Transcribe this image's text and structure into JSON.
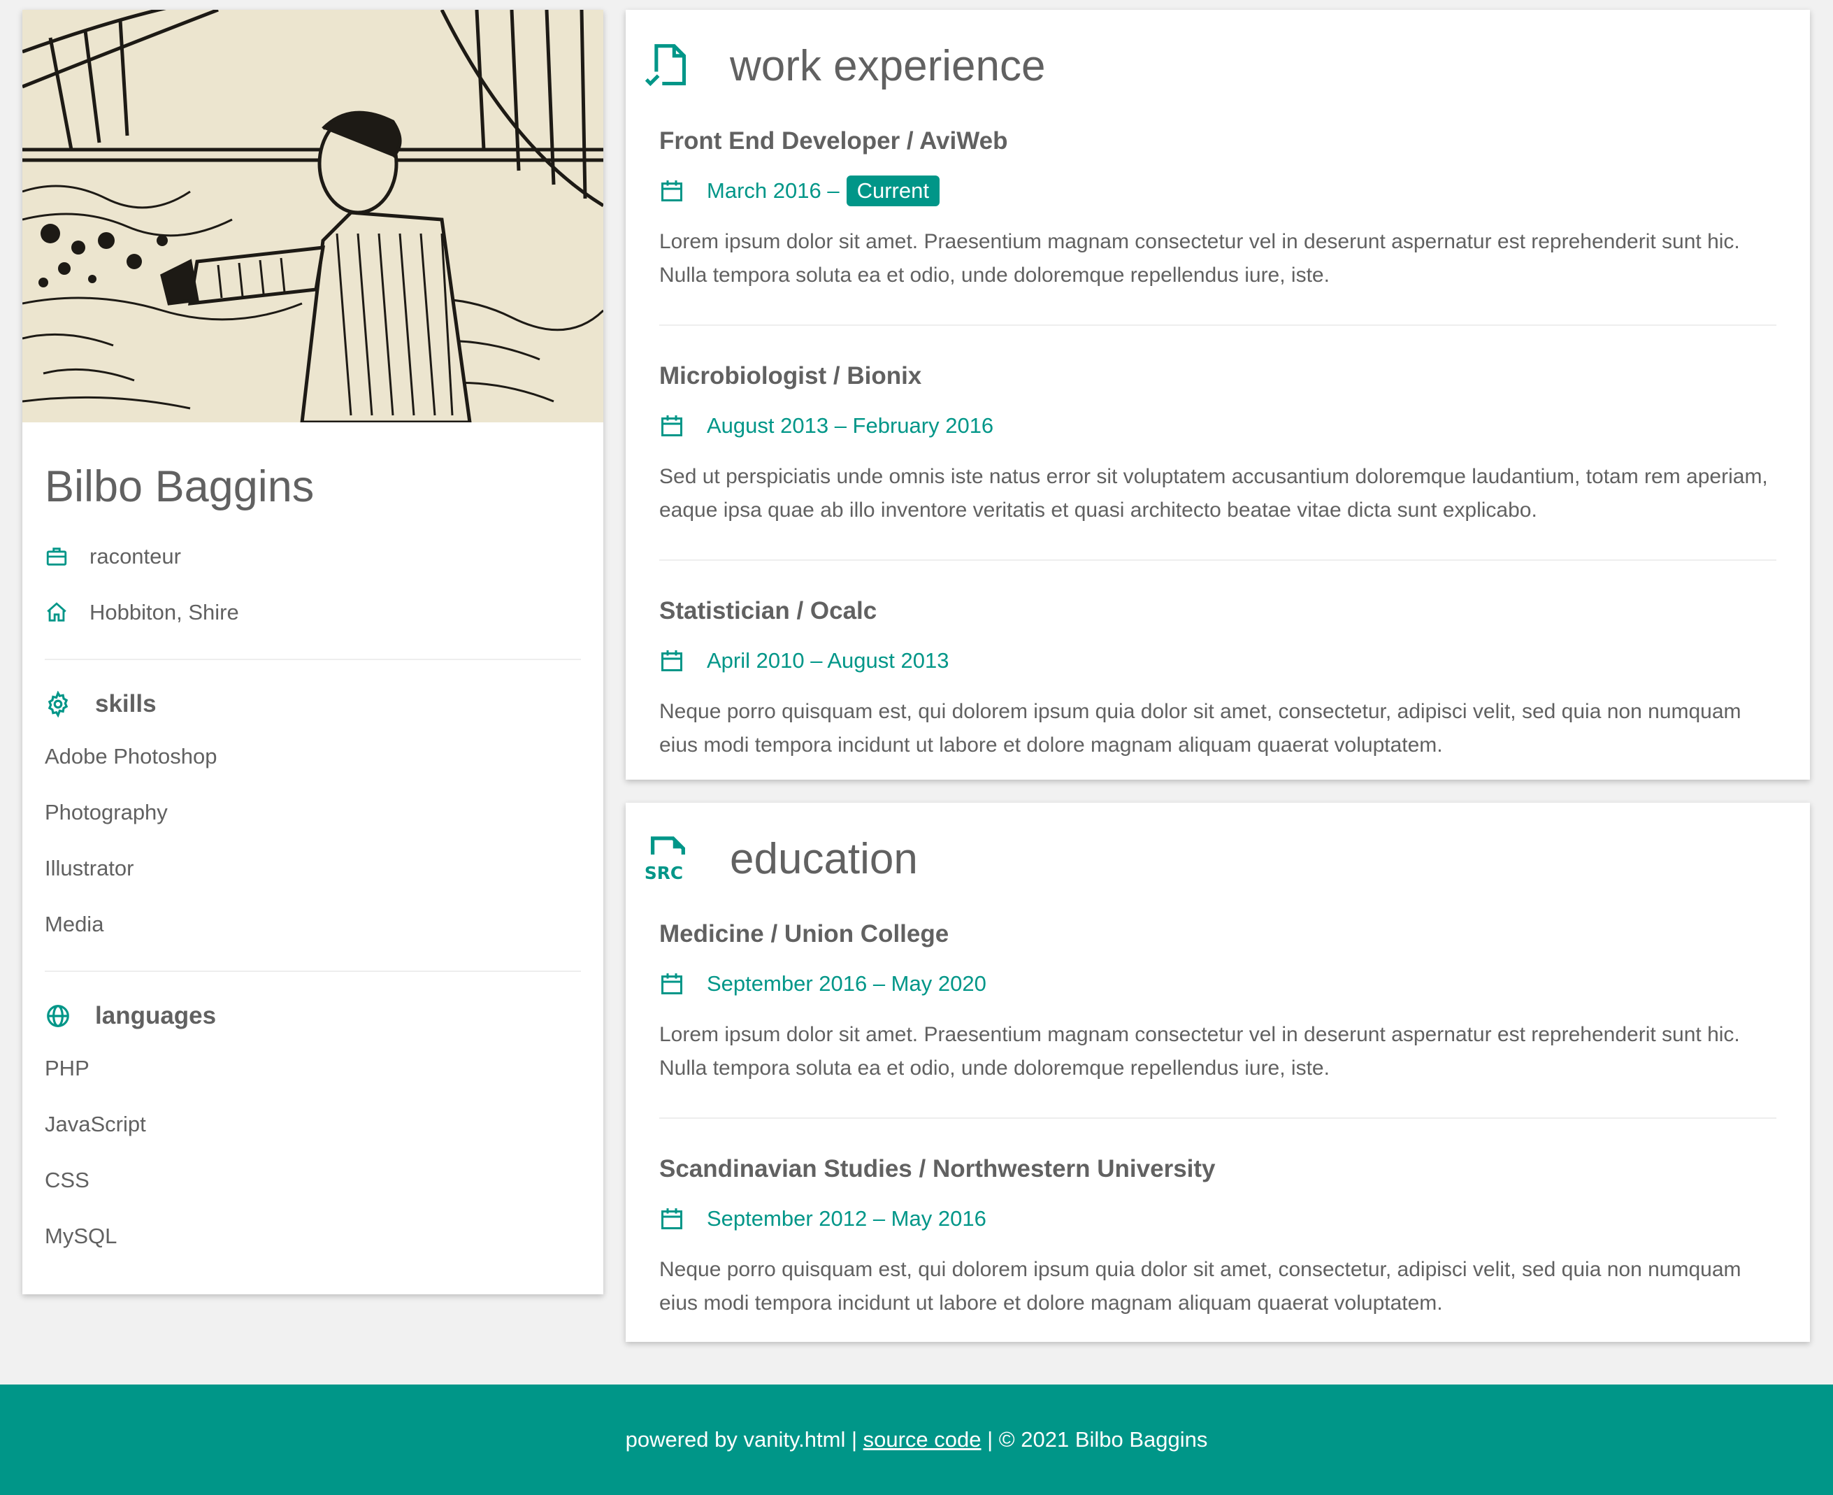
{
  "profile": {
    "name": "Bilbo Baggins",
    "occupation": "raconteur",
    "location": "Hobbiton, Shire"
  },
  "skills": {
    "title": "skills",
    "items": [
      "Adobe Photoshop",
      "Photography",
      "Illustrator",
      "Media"
    ]
  },
  "languages": {
    "title": "languages",
    "items": [
      "PHP",
      "JavaScript",
      "CSS",
      "MySQL"
    ]
  },
  "work": {
    "title": "work experience",
    "entries": [
      {
        "title": "Front End Developer / AviWeb",
        "date": "March 2016 –",
        "badge": "Current",
        "description": "Lorem ipsum dolor sit amet. Praesentium magnam consectetur vel in deserunt aspernatur est reprehenderit sunt hic. Nulla tempora soluta ea et odio, unde doloremque repellendus iure, iste."
      },
      {
        "title": "Microbiologist / Bionix",
        "date": "August 2013 – February 2016",
        "description": "Sed ut perspiciatis unde omnis iste natus error sit voluptatem accusantium doloremque laudantium, totam rem aperiam, eaque ipsa quae ab illo inventore veritatis et quasi architecto beatae vitae dicta sunt explicabo."
      },
      {
        "title": "Statistician / Ocalc",
        "date": "April 2010 – August 2013",
        "description": "Neque porro quisquam est, qui dolorem ipsum quia dolor sit amet, consectetur, adipisci velit, sed quia non numquam eius modi tempora incidunt ut labore et dolore magnam aliquam quaerat voluptatem."
      }
    ]
  },
  "education": {
    "title": "education",
    "icon_text": "SRC",
    "entries": [
      {
        "title": "Medicine / Union College",
        "date": "September 2016 – May 2020",
        "description": "Lorem ipsum dolor sit amet. Praesentium magnam consectetur vel in deserunt aspernatur est reprehenderit sunt hic. Nulla tempora soluta ea et odio, unde doloremque repellendus iure, iste."
      },
      {
        "title": "Scandinavian Studies / Northwestern University",
        "date": "September 2012 – May 2016",
        "description": "Neque porro quisquam est, qui dolorem ipsum quia dolor sit amet, consectetur, adipisci velit, sed quia non numquam eius modi tempora incidunt ut labore et dolore magnam aliquam quaerat voluptatem."
      }
    ]
  },
  "footer": {
    "prefix": "powered by vanity.html | ",
    "link": "source code",
    "suffix": " | © 2021 Bilbo Baggins"
  },
  "colors": {
    "accent": "#009688",
    "text": "#616161",
    "background": "#f1f1f1"
  },
  "icons": {
    "occupation": "briefcase-icon",
    "location": "home-icon",
    "skills": "gear-icon",
    "languages": "globe-icon",
    "work": "document-check-icon",
    "education": "document-src-icon",
    "date": "calendar-icon"
  }
}
